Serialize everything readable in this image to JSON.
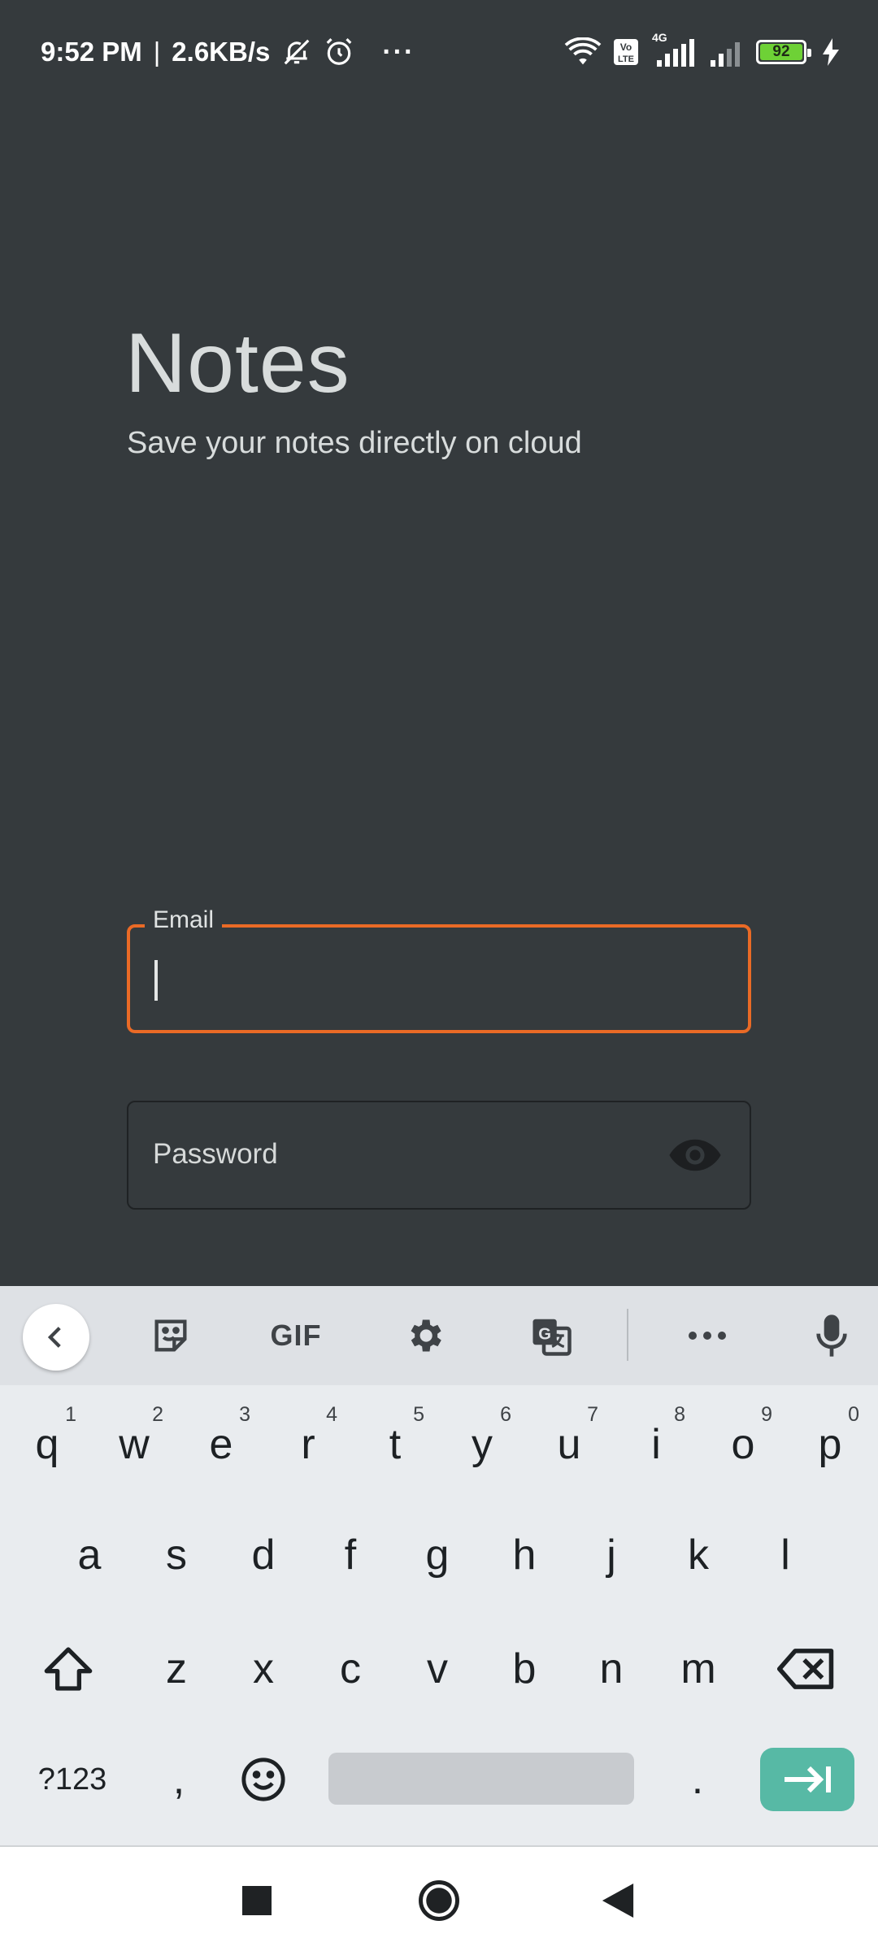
{
  "status_bar": {
    "time": "9:52 PM",
    "separator": "|",
    "speed": "2.6KB/s",
    "more": "···",
    "network_label": "4G",
    "volte_label": "Vo LTE",
    "battery_level": "92",
    "icons": [
      "bell-off-icon",
      "alarm-icon",
      "wifi-icon",
      "volte-icon",
      "signal-icon",
      "signal-weak-icon",
      "battery-icon",
      "charging-icon"
    ]
  },
  "header": {
    "title": "Notes",
    "subtitle": "Save your notes directly on cloud"
  },
  "form": {
    "email": {
      "label": "Email",
      "value": ""
    },
    "password": {
      "placeholder": "Password",
      "toggle_icon": "eye-icon"
    }
  },
  "keyboard": {
    "toolbar": {
      "collapse_icon": "chevron-left-icon",
      "sticker_icon": "sticker-icon",
      "gif_label": "GIF",
      "settings_icon": "gear-icon",
      "translate_icon": "translate-icon",
      "more_icon": "more-horizontal-icon",
      "mic_icon": "microphone-icon"
    },
    "row1": [
      {
        "key": "q",
        "hint": "1"
      },
      {
        "key": "w",
        "hint": "2"
      },
      {
        "key": "e",
        "hint": "3"
      },
      {
        "key": "r",
        "hint": "4"
      },
      {
        "key": "t",
        "hint": "5"
      },
      {
        "key": "y",
        "hint": "6"
      },
      {
        "key": "u",
        "hint": "7"
      },
      {
        "key": "i",
        "hint": "8"
      },
      {
        "key": "o",
        "hint": "9"
      },
      {
        "key": "p",
        "hint": "0"
      }
    ],
    "row2": [
      "a",
      "s",
      "d",
      "f",
      "g",
      "h",
      "j",
      "k",
      "l"
    ],
    "row3": [
      "z",
      "x",
      "c",
      "v",
      "b",
      "n",
      "m"
    ],
    "row4": {
      "symbols": "?123",
      "comma": ",",
      "period": "."
    }
  },
  "colors": {
    "background": "#353a3d",
    "accent": "#ea6a26",
    "keyboard_bg": "#e9ecef",
    "enter_key": "#57b9a5"
  }
}
